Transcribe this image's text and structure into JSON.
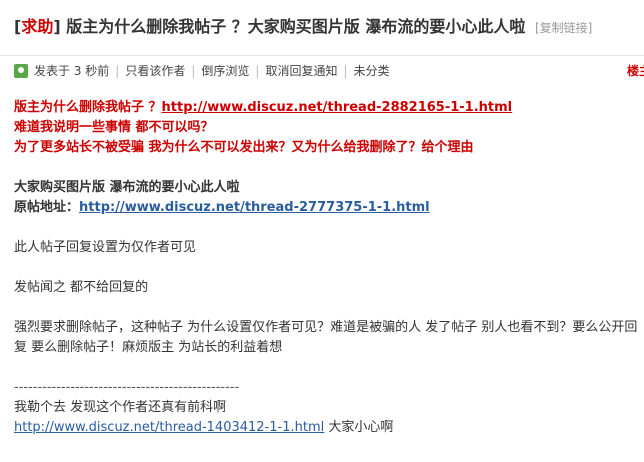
{
  "thread": {
    "tag_open": "[",
    "tag": "求助",
    "tag_close": "]",
    "title": "版主为什么删除我帖子 ？大家购买图片版 瀑布流的要小心此人啦",
    "copy_link": "[复制链接]"
  },
  "meta": {
    "posted": "发表于 3 秒前",
    "author_only": "只看该作者",
    "reverse": "倒序浏览",
    "cancel_notify": "取消回复通知",
    "category": "未分类",
    "floor": "楼主"
  },
  "post": {
    "line1_text": "版主为什么删除我帖子 ？",
    "line1_link": "http://www.discuz.net/thread-2882165-1-1.html",
    "line2": "难道我说明一些事情 都不可以吗？",
    "line3": "为了更多站长不被受骗 我为什么不可以发出来？又为什么给我删除了？给个理由",
    "line4": "大家购买图片版 瀑布流的要小心此人啦",
    "line5_label": "原帖地址：",
    "line5_link": "http://www.discuz.net/thread-2777375-1-1.html",
    "line6": "此人帖子回复设置为仅作者可见",
    "line7": "发帖闻之 都不给回复的",
    "line8": "强烈要求删除帖子，这种帖子 为什么设置仅作者可见？难道是被骗的人 发了帖子 别人也看不到？要么公开回复 要么删除帖子！麻烦版主 为站长的利益着想",
    "divider": "------------------------------------------------",
    "line9": "我勒个去 发现这个作者还真有前科啊",
    "line10_link": "http://www.discuz.net/thread-1403412-1-1.html",
    "line10_text": " 大家小心啊"
  }
}
